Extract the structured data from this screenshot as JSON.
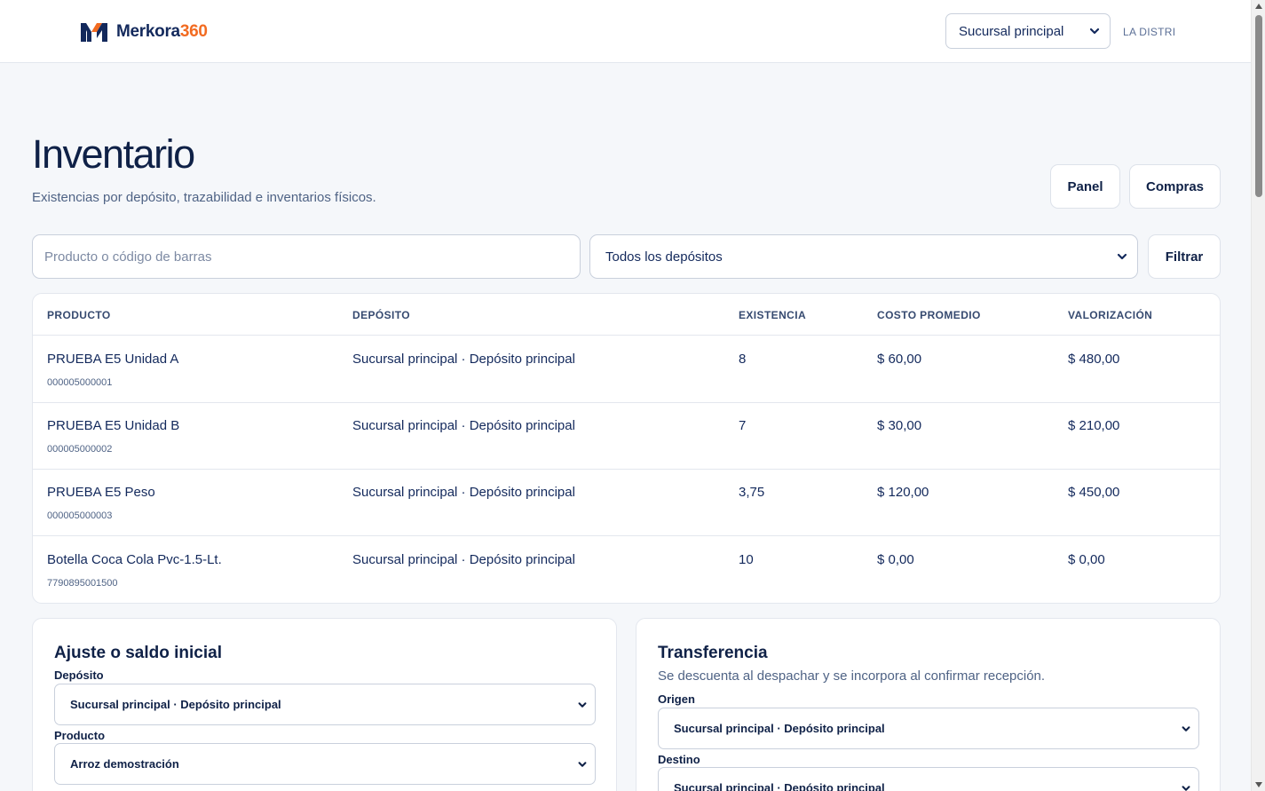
{
  "brand": {
    "name": "Merkora",
    "suffix": "360",
    "accent_color": "#f26b21",
    "primary_color": "#13295c"
  },
  "header": {
    "branch_selected": "Sucursal principal",
    "company": "LA DISTRI"
  },
  "page": {
    "title": "Inventario",
    "subtitle": "Existencias por depósito, trazabilidad e inventarios físicos."
  },
  "actions": {
    "panel": "Panel",
    "compras": "Compras"
  },
  "filters": {
    "search_placeholder": "Producto o código de barras",
    "search_value": "",
    "deposit_selected": "Todos los depósitos",
    "filter_button": "Filtrar"
  },
  "table": {
    "headers": [
      "PRODUCTO",
      "DEPÓSITO",
      "EXISTENCIA",
      "COSTO PROMEDIO",
      "VALORIZACIÓN"
    ],
    "rows": [
      {
        "product": "PRUEBA E5 Unidad A",
        "code": "000005000001",
        "deposit": "Sucursal principal · Depósito principal",
        "stock": "8",
        "avg_cost": "$ 60,00",
        "valuation": "$ 480,00"
      },
      {
        "product": "PRUEBA E5 Unidad B",
        "code": "000005000002",
        "deposit": "Sucursal principal · Depósito principal",
        "stock": "7",
        "avg_cost": "$ 30,00",
        "valuation": "$ 210,00"
      },
      {
        "product": "PRUEBA E5 Peso",
        "code": "000005000003",
        "deposit": "Sucursal principal · Depósito principal",
        "stock": "3,75",
        "avg_cost": "$ 120,00",
        "valuation": "$ 450,00"
      },
      {
        "product": "Botella Coca Cola Pvc-1.5-Lt.",
        "code": "7790895001500",
        "deposit": "Sucursal principal · Depósito principal",
        "stock": "10",
        "avg_cost": "$ 0,00",
        "valuation": "$ 0,00"
      }
    ]
  },
  "adjustment": {
    "title": "Ajuste o saldo inicial",
    "deposit_label": "Depósito",
    "deposit_value": "Sucursal principal · Depósito principal",
    "product_label": "Producto",
    "product_value": "Arroz demostración"
  },
  "transfer": {
    "title": "Transferencia",
    "description": "Se descuenta al despachar y se incorpora al confirmar recepción.",
    "origin_label": "Origen",
    "origin_value": "Sucursal principal · Depósito principal",
    "destination_label": "Destino",
    "destination_value": "Sucursal principal · Depósito principal"
  }
}
